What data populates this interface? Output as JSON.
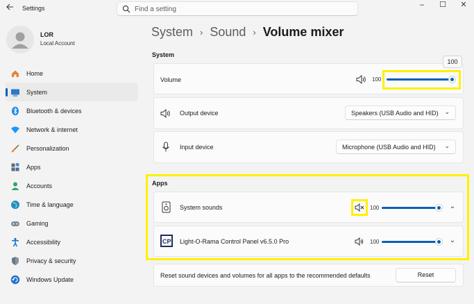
{
  "window": {
    "app_title": "Settings",
    "controls": [
      "–",
      "☐",
      "✕"
    ]
  },
  "search": {
    "placeholder": "Find a setting"
  },
  "profile": {
    "name": "LOR",
    "account": "Local Account"
  },
  "sidebar": {
    "items": [
      {
        "label": "Home",
        "icon": "home-icon",
        "color": "#e3843b"
      },
      {
        "label": "System",
        "icon": "system-icon",
        "color": "#2b79c7",
        "active": true
      },
      {
        "label": "Bluetooth & devices",
        "icon": "bluetooth-icon",
        "color": "#1e88e5"
      },
      {
        "label": "Network & internet",
        "icon": "network-icon",
        "color": "#2196f3"
      },
      {
        "label": "Personalization",
        "icon": "brush-icon",
        "color": "#e67e22"
      },
      {
        "label": "Apps",
        "icon": "apps-icon",
        "color": "#5b6b7a"
      },
      {
        "label": "Accounts",
        "icon": "accounts-icon",
        "color": "#2fa36b"
      },
      {
        "label": "Time & language",
        "icon": "globe-icon",
        "color": "#1f8ad6"
      },
      {
        "label": "Gaming",
        "icon": "gaming-icon",
        "color": "#7d8a96"
      },
      {
        "label": "Accessibility",
        "icon": "accessibility-icon",
        "color": "#1a73c9"
      },
      {
        "label": "Privacy & security",
        "icon": "shield-icon",
        "color": "#6b7785"
      },
      {
        "label": "Windows Update",
        "icon": "update-icon",
        "color": "#1d6fd0"
      }
    ]
  },
  "breadcrumb": {
    "part1": "System",
    "part2": "Sound",
    "current": "Volume mixer",
    "sep": "›"
  },
  "system_section": {
    "title": "System",
    "volume": {
      "label": "Volume",
      "value": "100",
      "tooltip": "100",
      "level": 1.0
    },
    "output": {
      "label": "Output device",
      "selected": "Speakers (USB Audio and HID)"
    },
    "input": {
      "label": "Input device",
      "selected": "Microphone (USB Audio and HID)"
    }
  },
  "apps_section": {
    "title": "Apps",
    "apps": [
      {
        "name": "System sounds",
        "value": "100",
        "muted": true,
        "level": 1.0
      },
      {
        "name": "Light-O-Rama Control Panel v6.5.0 Pro",
        "value": "100",
        "muted": false,
        "level": 1.0
      }
    ]
  },
  "reset": {
    "text": "Reset sound devices and volumes for all apps to the recommended defaults",
    "button": "Reset"
  },
  "colors": {
    "accent": "#005fb8",
    "highlight": "#fff000"
  }
}
